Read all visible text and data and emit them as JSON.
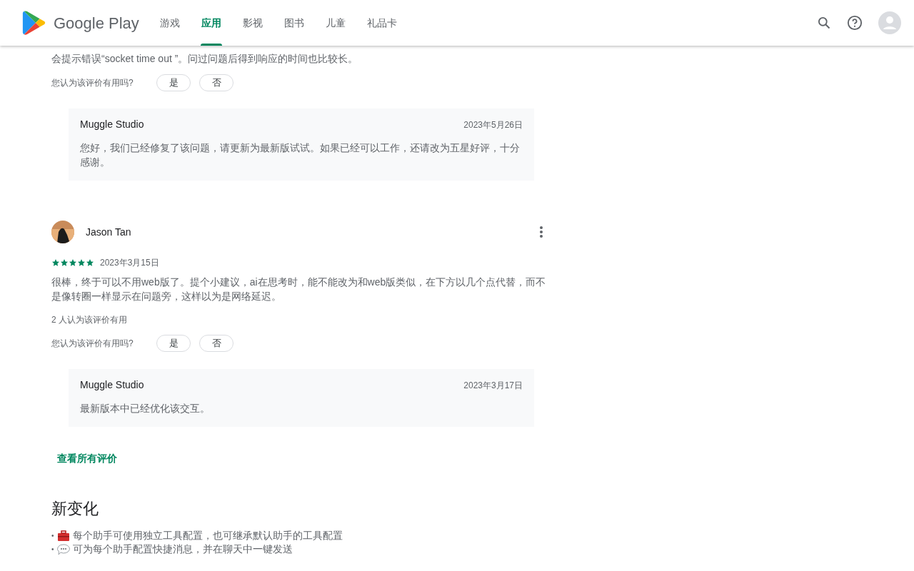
{
  "header": {
    "brand": "Google Play",
    "tabs": [
      {
        "label": "游戏",
        "selected": false
      },
      {
        "label": "应用",
        "selected": true
      },
      {
        "label": "影视",
        "selected": false
      },
      {
        "label": "图书",
        "selected": false
      },
      {
        "label": "儿童",
        "selected": false
      },
      {
        "label": "礼品卡",
        "selected": false
      }
    ]
  },
  "first_review": {
    "text": "会提示错误“socket time out ”。问过问题后得到响应的时间也比较长。",
    "helpful_question": "您认为该评价有用吗?",
    "yes": "是",
    "no": "否",
    "reply": {
      "author": "Muggle Studio",
      "date": "2023年5月26日",
      "text": "您好，我们已经修复了该问题，请更新为最新版试试。如果已经可以工作，还请改为五星好评，十分感谢。"
    }
  },
  "second_review": {
    "author": "Jason Tan",
    "stars": 5,
    "date": "2023年3月15日",
    "text": "很棒，终于可以不用web版了。提个小建议，ai在思考时，能不能改为和web版类似，在下方以几个点代替，而不是像转圈一样显示在问题旁，这样以为是网络延迟。",
    "helpful_count": "2 人认为该评价有用",
    "helpful_question": "您认为该评价有用吗?",
    "yes": "是",
    "no": "否",
    "reply": {
      "author": "Muggle Studio",
      "date": "2023年3月17日",
      "text": "最新版本中已经优化该交互。"
    }
  },
  "see_all": "查看所有评价",
  "whats_new": {
    "title": "新变化",
    "items": [
      {
        "kind": "toolbox",
        "bullet": "•",
        "text": "每个助手可使用独立工具配置，也可继承默认助手的工具配置"
      },
      {
        "kind": "speech",
        "bullet": "•",
        "text": "可为每个助手配置快捷消息，并在聊天中一键发送"
      }
    ]
  }
}
